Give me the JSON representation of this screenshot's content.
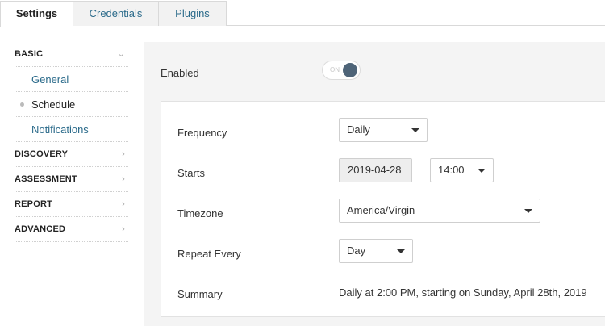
{
  "tabs": [
    {
      "label": "Settings",
      "active": true
    },
    {
      "label": "Credentials",
      "active": false
    },
    {
      "label": "Plugins",
      "active": false
    }
  ],
  "sidebar": {
    "sections": [
      {
        "label": "BASIC",
        "expanded": true,
        "items": [
          {
            "label": "General"
          },
          {
            "label": "Schedule",
            "current": true
          },
          {
            "label": "Notifications"
          }
        ]
      },
      {
        "label": "DISCOVERY",
        "expanded": false
      },
      {
        "label": "ASSESSMENT",
        "expanded": false
      },
      {
        "label": "REPORT",
        "expanded": false
      },
      {
        "label": "ADVANCED",
        "expanded": false
      }
    ]
  },
  "schedule": {
    "enabled_label": "Enabled",
    "toggle_text": "ON",
    "enabled": true,
    "frequency_label": "Frequency",
    "frequency_value": "Daily",
    "starts_label": "Starts",
    "start_date": "2019-04-28",
    "start_time": "14:00",
    "timezone_label": "Timezone",
    "timezone_value": "America/Virgin",
    "repeat_label": "Repeat Every",
    "repeat_value": "Day",
    "summary_label": "Summary",
    "summary_text": "Daily at 2:00 PM, starting on Sunday, April 28th, 2019"
  },
  "colors": {
    "link": "#2a6a8a",
    "toggle_knob": "#4e6478",
    "main_bg": "#f4f4f4"
  }
}
